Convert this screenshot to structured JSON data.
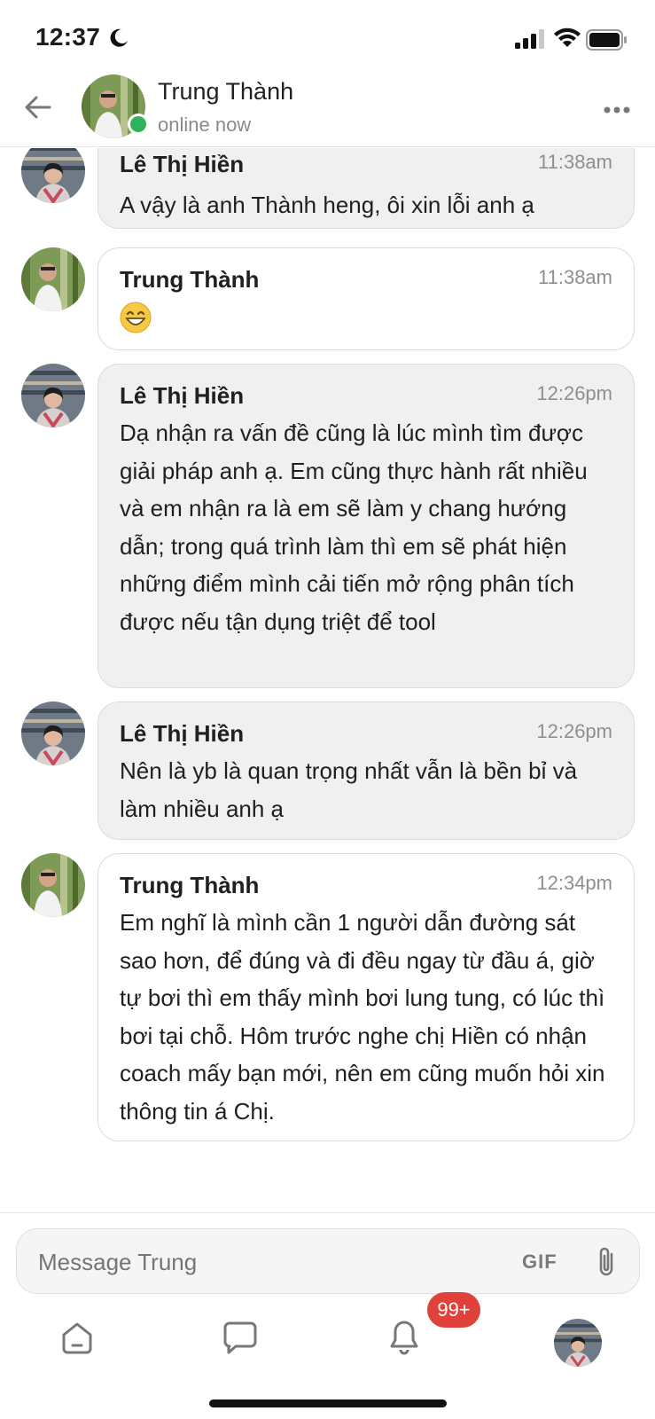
{
  "status_bar": {
    "time": "12:37"
  },
  "header": {
    "name": "Trung Thành",
    "status": "online now",
    "online_color": "#2fb35a"
  },
  "messages": [
    {
      "sender": "Lê Thị Hiền",
      "time": "11:38am",
      "text": "A vậy là anh Thành heng, ôi xin lỗi anh ạ",
      "style": "gray",
      "avatar": "hien-avatar"
    },
    {
      "sender": "Trung Thành",
      "time": "11:38am",
      "text": "",
      "emoji": "grinning-face-icon",
      "style": "white",
      "avatar": "thanh-avatar"
    },
    {
      "sender": "Lê Thị Hiền",
      "time": "12:26pm",
      "text": "Dạ nhận ra vấn đề cũng là lúc mình tìm được giải pháp anh ạ. Em cũng thực hành rất nhiều và em nhận ra là em sẽ làm y chang hướng dẫn; trong quá trình làm thì em sẽ phát hiện những điểm mình cải tiến mở rộng phân tích được nếu tận dụng triệt để tool",
      "style": "gray",
      "avatar": "hien-avatar"
    },
    {
      "sender": "Lê Thị Hiền",
      "time": "12:26pm",
      "text": "Nên là yb là quan trọng nhất vẫn là bền bỉ và làm nhiều anh ạ",
      "style": "gray",
      "avatar": "hien-avatar"
    },
    {
      "sender": "Trung Thành",
      "time": "12:34pm",
      "text": "Em nghĩ là mình cần 1 người dẫn đường sát sao hơn, để đúng và đi đều ngay từ đầu á, giờ tự bơi thì em thấy mình bơi lung tung, có lúc thì bơi tại chỗ. Hôm trước nghe chị Hiền có nhận coach mấy bạn mới, nên em cũng muốn hỏi xin thông tin á Chị.",
      "style": "white",
      "avatar": "thanh-avatar"
    }
  ],
  "composer": {
    "placeholder": "Message Trung",
    "gif_label": "GIF"
  },
  "tab_bar": {
    "items": [
      "home-icon",
      "chat-icon",
      "bell-icon",
      "profile-avatar"
    ],
    "notification_badge": "99+",
    "badge_color": "#e0413a"
  }
}
